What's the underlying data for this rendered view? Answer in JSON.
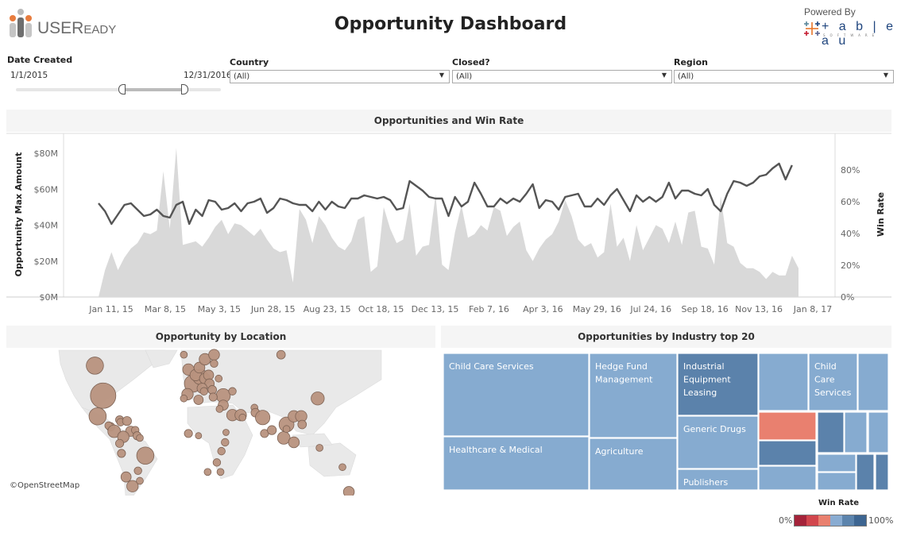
{
  "header": {
    "logo_text_main": "USER",
    "logo_text_small": "EADY",
    "title": "Opportunity Dashboard",
    "powered_by": "Powered By",
    "tableau_text": "+ a b | e a u",
    "tableau_sub": "SOFTWARE"
  },
  "filters": {
    "date": {
      "label": "Date Created",
      "start": "1/1/2015",
      "end": "12/31/2016"
    },
    "country": {
      "label": "Country",
      "value": "(All)"
    },
    "closed": {
      "label": "Closed?",
      "value": "(All)"
    },
    "region": {
      "label": "Region",
      "value": "(All)"
    }
  },
  "sections": {
    "chart_title": "Opportunities and Win Rate",
    "map_title": "Opportunity by Location",
    "treemap_title": "Opportunities by Industry top 20",
    "map_credit": "©OpenStreetMap"
  },
  "colors": {
    "area": "#d9d9d9",
    "line": "#555555",
    "bubble": "#b8927e",
    "bubble_stroke": "#7d6355",
    "land": "#e9e9e9",
    "legend": [
      "#a4233a",
      "#d1464d",
      "#e9806f",
      "#89acd2",
      "#5c84ad",
      "#3d6591"
    ]
  },
  "legend": {
    "title": "Win Rate",
    "min": "0%",
    "max": "100%"
  },
  "chart_data": [
    {
      "type": "area+line",
      "title": "Opportunities and Win Rate",
      "xlabel": "",
      "ylabel": "Opportunity Max Amount",
      "y2label": "Win Rate",
      "ylim": [
        0,
        80
      ],
      "y_ticks": [
        "$0M",
        "$20M",
        "$40M",
        "$60M",
        "$80M"
      ],
      "y2lim": [
        0,
        100
      ],
      "y2_ticks": [
        "0%",
        "20%",
        "40%",
        "60%",
        "80%"
      ],
      "x_ticks": [
        "Jan 11, 15",
        "Mar 8, 15",
        "May 3, 15",
        "Jun 28, 15",
        "Aug 23, 15",
        "Oct 18, 15",
        "Dec 13, 15",
        "Feb 7, 16",
        "Apr 3, 16",
        "May 29, 16",
        "Jul 24, 16",
        "Sep 18, 16",
        "Nov 13, 16",
        "Jan 8, 17"
      ],
      "x_granularity": "weekly",
      "series": [
        {
          "name": "Opportunity Max Amount ($M)",
          "type": "area",
          "values": [
            0,
            15,
            25,
            15,
            22,
            27,
            30,
            36,
            35,
            37,
            70,
            38,
            83,
            29,
            30,
            31,
            28,
            33,
            39,
            43,
            35,
            41,
            40,
            37,
            34,
            38,
            32,
            27,
            25,
            26,
            8,
            49,
            43,
            30,
            45,
            40,
            33,
            28,
            26,
            31,
            43,
            45,
            14,
            17,
            50,
            38,
            30,
            32,
            52,
            23,
            28,
            29,
            57,
            18,
            15,
            36,
            51,
            33,
            35,
            40,
            37,
            50,
            48,
            34,
            39,
            42,
            26,
            20,
            27,
            32,
            35,
            42,
            54,
            45,
            32,
            28,
            30,
            22,
            25,
            52,
            28,
            33,
            20,
            40,
            26,
            33,
            40,
            38,
            30,
            42,
            29,
            47,
            48,
            28,
            27,
            18,
            56,
            30,
            28,
            19,
            16,
            16,
            14,
            10,
            14,
            12,
            12,
            23,
            16
          ]
        },
        {
          "name": "Win Rate (%)",
          "type": "line",
          "values": [
            59,
            54,
            46,
            52,
            58,
            59,
            55,
            51,
            52,
            55,
            51,
            50,
            58,
            60,
            46,
            55,
            51,
            61,
            60,
            55,
            56,
            59,
            54,
            59,
            60,
            62,
            53,
            56,
            62,
            61,
            59,
            58,
            58,
            54,
            60,
            55,
            60,
            57,
            56,
            62,
            62,
            64,
            63,
            62,
            63,
            61,
            55,
            56,
            73,
            70,
            67,
            63,
            62,
            62,
            51,
            63,
            57,
            60,
            72,
            65,
            57,
            57,
            62,
            59,
            62,
            60,
            65,
            71,
            56,
            61,
            60,
            55,
            63,
            64,
            65,
            57,
            57,
            62,
            58,
            64,
            68,
            61,
            54,
            64,
            60,
            63,
            60,
            63,
            72,
            62,
            67,
            67,
            65,
            64,
            68,
            58,
            54,
            65,
            73,
            72,
            70,
            72,
            76,
            77,
            81,
            84,
            74,
            83
          ]
        }
      ]
    },
    {
      "type": "map-bubble",
      "title": "Opportunity by Location",
      "points": [
        {
          "lon": -96,
          "lat": 39,
          "value": 100
        },
        {
          "lon": -105,
          "lat": 57,
          "value": 40
        },
        {
          "lon": -102,
          "lat": 23,
          "value": 40
        },
        {
          "lon": -88,
          "lat": 14,
          "value": 6
        },
        {
          "lon": -90,
          "lat": 15,
          "value": 4
        },
        {
          "lon": -84,
          "lat": 10,
          "value": 18
        },
        {
          "lon": -78,
          "lat": 20,
          "value": 5
        },
        {
          "lon": -77,
          "lat": 18,
          "value": 4
        },
        {
          "lon": -70,
          "lat": 19,
          "value": 7
        },
        {
          "lon": -66,
          "lat": 10,
          "value": 10
        },
        {
          "lon": -74,
          "lat": 5,
          "value": 14
        },
        {
          "lon": -61,
          "lat": 11,
          "value": 4
        },
        {
          "lon": -59,
          "lat": 6,
          "value": 5
        },
        {
          "lon": -56,
          "lat": 4,
          "value": 3
        },
        {
          "lon": -78,
          "lat": -1,
          "value": 5
        },
        {
          "lon": -76,
          "lat": -10,
          "value": 5
        },
        {
          "lon": -50,
          "lat": -12,
          "value": 40
        },
        {
          "lon": -71,
          "lat": -30,
          "value": 10
        },
        {
          "lon": -58,
          "lat": -25,
          "value": 4
        },
        {
          "lon": -64,
          "lat": -37,
          "value": 14
        },
        {
          "lon": -56,
          "lat": -33,
          "value": 3
        },
        {
          "lon": -3,
          "lat": 55,
          "value": 14
        },
        {
          "lon": -8,
          "lat": 62,
          "value": 3
        },
        {
          "lon": 2,
          "lat": 47,
          "value": 40
        },
        {
          "lon": -4,
          "lat": 40,
          "value": 14
        },
        {
          "lon": -8,
          "lat": 37,
          "value": 3
        },
        {
          "lon": 10,
          "lat": 51,
          "value": 30
        },
        {
          "lon": 5,
          "lat": 52,
          "value": 14
        },
        {
          "lon": 9,
          "lat": 56,
          "value": 12
        },
        {
          "lon": 15,
          "lat": 60,
          "value": 14
        },
        {
          "lon": 25,
          "lat": 62,
          "value": 12
        },
        {
          "lon": 25,
          "lat": 58,
          "value": 4
        },
        {
          "lon": 15,
          "lat": 50,
          "value": 12
        },
        {
          "lon": 19,
          "lat": 52,
          "value": 10
        },
        {
          "lon": 20,
          "lat": 47,
          "value": 8
        },
        {
          "lon": 12,
          "lat": 44,
          "value": 10
        },
        {
          "lon": 23,
          "lat": 43,
          "value": 6
        },
        {
          "lon": 30,
          "lat": 50,
          "value": 3
        },
        {
          "lon": 35,
          "lat": 39,
          "value": 24
        },
        {
          "lon": 24,
          "lat": 38,
          "value": 5
        },
        {
          "lon": 14,
          "lat": 42,
          "value": 4
        },
        {
          "lon": 8,
          "lat": 36,
          "value": 8
        },
        {
          "lon": 45,
          "lat": 42,
          "value": 4
        },
        {
          "lon": 35,
          "lat": 32,
          "value": 10
        },
        {
          "lon": 31,
          "lat": 29,
          "value": 3
        },
        {
          "lon": 45,
          "lat": 24,
          "value": 14
        },
        {
          "lon": 54,
          "lat": 24,
          "value": 14
        },
        {
          "lon": 56,
          "lat": 22,
          "value": 3
        },
        {
          "lon": 69,
          "lat": 30,
          "value": 3
        },
        {
          "lon": 70,
          "lat": 26,
          "value": 6
        },
        {
          "lon": 78,
          "lat": 22,
          "value": 26
        },
        {
          "lon": 80,
          "lat": 8,
          "value": 5
        },
        {
          "lon": 88,
          "lat": 11,
          "value": 7
        },
        {
          "lon": 104,
          "lat": 16,
          "value": 28
        },
        {
          "lon": 112,
          "lat": 23,
          "value": 14
        },
        {
          "lon": 120,
          "lat": 23,
          "value": 14
        },
        {
          "lon": 121,
          "lat": 16,
          "value": 6
        },
        {
          "lon": 101,
          "lat": 4,
          "value": 18
        },
        {
          "lon": 112,
          "lat": 0,
          "value": 12
        },
        {
          "lon": 104,
          "lat": 12,
          "value": 3
        },
        {
          "lon": 138,
          "lat": 37,
          "value": 20
        },
        {
          "lon": 98,
          "lat": 62,
          "value": 6
        },
        {
          "lon": 140,
          "lat": -5,
          "value": 3
        },
        {
          "lon": 165,
          "lat": -22,
          "value": 3
        },
        {
          "lon": 172,
          "lat": -41,
          "value": 12
        },
        {
          "lon": -3,
          "lat": 8,
          "value": 5
        },
        {
          "lon": 8,
          "lat": 6,
          "value": 2
        },
        {
          "lon": 38,
          "lat": 9,
          "value": 2
        },
        {
          "lon": 37,
          "lat": 0,
          "value": 4
        },
        {
          "lon": 33,
          "lat": -8,
          "value": 4
        },
        {
          "lon": 28,
          "lat": -18,
          "value": 4
        },
        {
          "lon": 32,
          "lat": -26,
          "value": 3
        },
        {
          "lon": 18,
          "lat": -26,
          "value": 3
        }
      ]
    },
    {
      "type": "treemap",
      "title": "Opportunities by Industry top 20",
      "color_metric": "Win Rate",
      "nodes": [
        {
          "label": "Child Care Services",
          "win_rate": 0.62
        },
        {
          "label": "Healthcare & Medical",
          "win_rate": 0.62
        },
        {
          "label": "Hedge Fund Management",
          "win_rate": 0.62
        },
        {
          "label": "Agriculture",
          "win_rate": 0.62
        },
        {
          "label": "Industrial Equipment Leasing",
          "win_rate": 0.78
        },
        {
          "label": "Generic Drugs",
          "win_rate": 0.62
        },
        {
          "label": "Publishers",
          "win_rate": 0.62
        },
        {
          "label": "",
          "win_rate": 0.62
        },
        {
          "label": "Child Care Services",
          "win_rate": 0.62
        },
        {
          "label": "",
          "win_rate": 0.62
        },
        {
          "label": "",
          "win_rate": 0.45
        },
        {
          "label": "",
          "win_rate": 0.78
        },
        {
          "label": "",
          "win_rate": 0.62
        },
        {
          "label": "",
          "win_rate": 0.78
        },
        {
          "label": "",
          "win_rate": 0.62
        },
        {
          "label": "",
          "win_rate": 0.62
        },
        {
          "label": "",
          "win_rate": 0.62
        },
        {
          "label": "",
          "win_rate": 0.62
        },
        {
          "label": "",
          "win_rate": 0.78
        },
        {
          "label": "",
          "win_rate": 0.78
        }
      ]
    }
  ]
}
